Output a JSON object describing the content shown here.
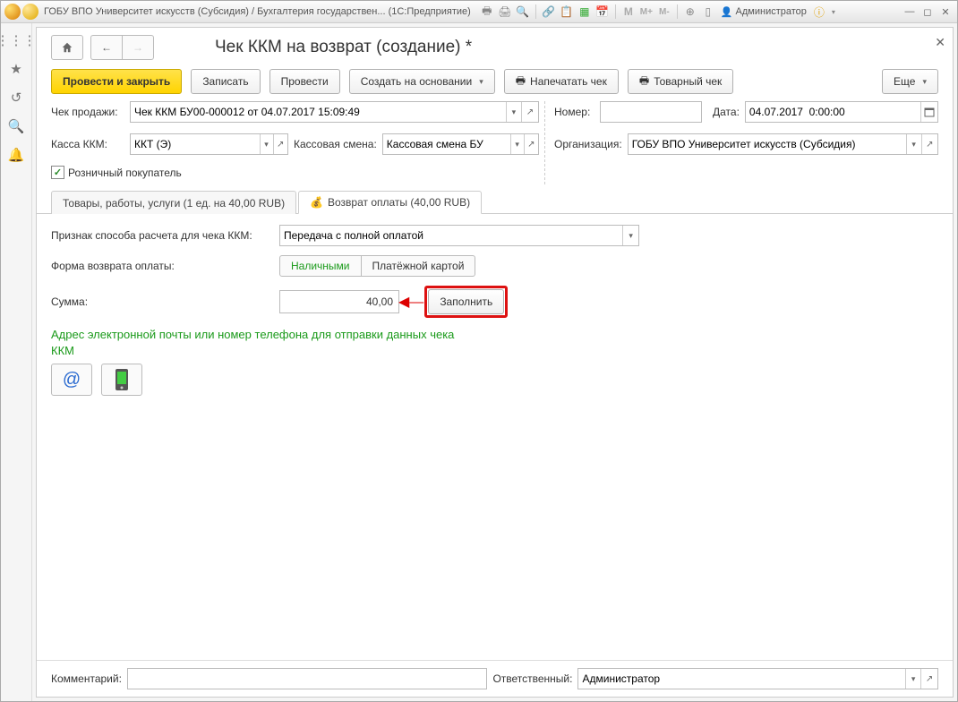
{
  "titlebar": {
    "text": "ГОБУ ВПО Университет искусств (Субсидия) / Бухгалтерия государствен... (1С:Предприятие)",
    "user": "Администратор"
  },
  "doc": {
    "title": "Чек ККМ на возврат (создание) *"
  },
  "toolbar": {
    "post_close": "Провести и закрыть",
    "write": "Записать",
    "post": "Провести",
    "create_based": "Создать на основании",
    "print_check": "Напечатать чек",
    "goods_check": "Товарный чек",
    "more": "Еще"
  },
  "fields": {
    "sale_check_lbl": "Чек продажи:",
    "sale_check_val": "Чек ККМ БУ00-000012 от 04.07.2017 15:09:49",
    "number_lbl": "Номер:",
    "number_val": "",
    "date_lbl": "Дата:",
    "date_val": "04.07.2017  0:00:00",
    "kkm_lbl": "Касса ККМ:",
    "kkm_val": "ККТ (Э)",
    "shift_lbl": "Кассовая смена:",
    "shift_val": "Кассовая смена БУ",
    "org_lbl": "Организация:",
    "org_val": "ГОБУ ВПО Университет искусств (Субсидия)",
    "retail_lbl": "Розничный покупатель"
  },
  "tabs": {
    "goods": "Товары, работы, услуги (1 ед. на 40,00 RUB)",
    "refund": "Возврат оплаты (40,00 RUB)"
  },
  "refund": {
    "method_lbl": "Признак способа расчета для чека ККМ:",
    "method_val": "Передача с полной оплатой",
    "form_lbl": "Форма возврата оплаты:",
    "cash": "Наличными",
    "card": "Платёжной картой",
    "sum_lbl": "Сумма:",
    "sum_val": "40,00",
    "fill": "Заполнить",
    "contact_txt": "Адрес электронной почты или номер телефона для отправки данных чека ККМ"
  },
  "footer": {
    "comment_lbl": "Комментарий:",
    "comment_val": "",
    "resp_lbl": "Ответственный:",
    "resp_val": "Администратор"
  }
}
